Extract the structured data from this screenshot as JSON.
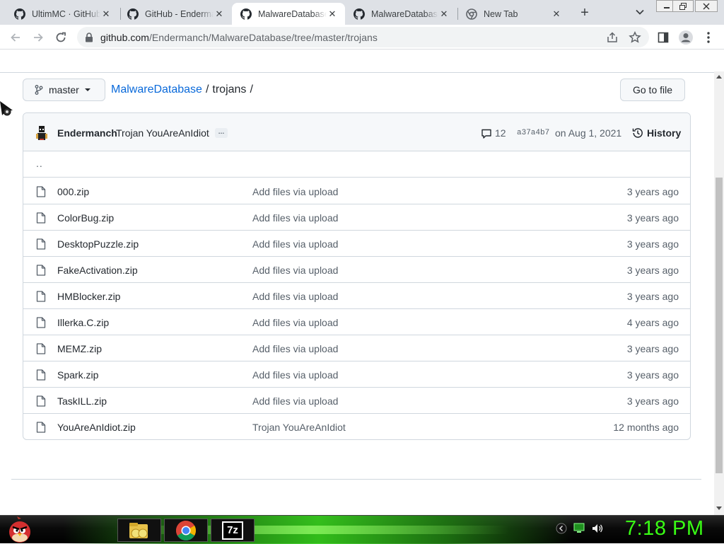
{
  "browser": {
    "tabs": [
      {
        "title": "UltimMC · GitHub",
        "favicon": "github-icon",
        "active": false
      },
      {
        "title": "GitHub - Endermanch/MalwareDatabase",
        "favicon": "github-icon",
        "active": false
      },
      {
        "title": "MalwareDatabase/trojans",
        "favicon": "github-icon",
        "active": true
      },
      {
        "title": "MalwareDatabase",
        "favicon": "github-icon",
        "active": false
      },
      {
        "title": "New Tab",
        "favicon": "chrome-icon",
        "active": false
      }
    ],
    "tab_close_glyph": "✕",
    "new_tab_glyph": "+",
    "url_host": "github.com",
    "url_path": "/Endermanch/MalwareDatabase/tree/master/trojans"
  },
  "repo": {
    "branch": "master",
    "repo_name": "MalwareDatabase",
    "sep": "/",
    "current_dir": "trojans",
    "trailing_sep": "/",
    "go_to_file": "Go to file"
  },
  "commit": {
    "author": "Endermanch",
    "message": "Trojan YouAreAnIdiot",
    "ellipsis": "…",
    "comments": "12",
    "sha": "a37a4b7",
    "date": "on Aug 1, 2021",
    "history": "History"
  },
  "parent_dir": "..",
  "files": [
    {
      "name": "000.zip",
      "commit": "Add files via upload",
      "age": "3 years ago"
    },
    {
      "name": "ColorBug.zip",
      "commit": "Add files via upload",
      "age": "3 years ago"
    },
    {
      "name": "DesktopPuzzle.zip",
      "commit": "Add files via upload",
      "age": "3 years ago"
    },
    {
      "name": "FakeActivation.zip",
      "commit": "Add files via upload",
      "age": "3 years ago"
    },
    {
      "name": "HMBlocker.zip",
      "commit": "Add files via upload",
      "age": "3 years ago"
    },
    {
      "name": "Illerka.C.zip",
      "commit": "Add files via upload",
      "age": "4 years ago"
    },
    {
      "name": "MEMZ.zip",
      "commit": "Add files via upload",
      "age": "3 years ago"
    },
    {
      "name": "Spark.zip",
      "commit": "Add files via upload",
      "age": "3 years ago"
    },
    {
      "name": "TaskILL.zip",
      "commit": "Add files via upload",
      "age": "3 years ago"
    },
    {
      "name": "YouAreAnIdiot.zip",
      "commit": "Trojan YouAreAnIdiot",
      "age": "12 months ago"
    }
  ],
  "taskbar": {
    "apps": [
      "file-explorer-icon",
      "chrome-icon",
      "7zip-icon"
    ],
    "seven_zip_label": "7z",
    "clock": "7:18 PM"
  },
  "colors": {
    "link": "#0969da",
    "taskbar_glow": "#37d11d",
    "clock": "#39ff14"
  }
}
